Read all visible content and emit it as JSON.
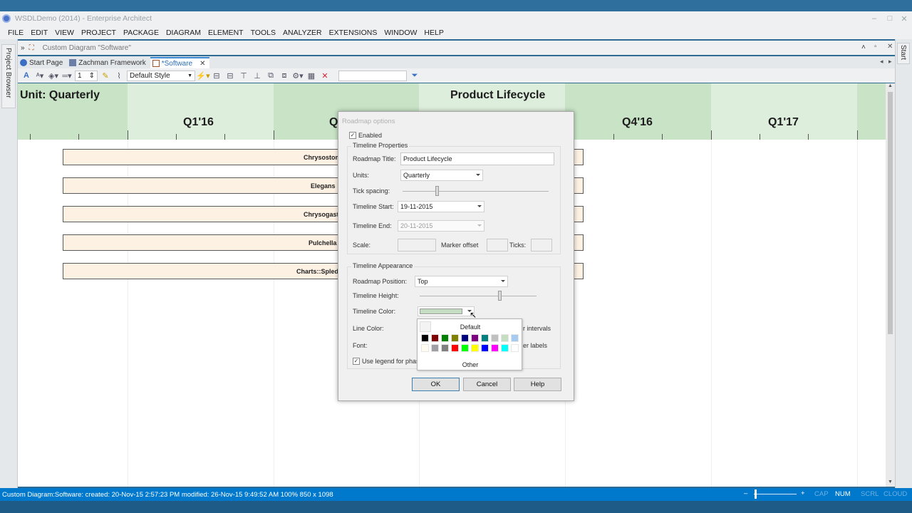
{
  "window": {
    "title": "WSDLDemo (2014) - Enterprise Architect"
  },
  "menu": [
    "FILE",
    "EDIT",
    "VIEW",
    "PROJECT",
    "PACKAGE",
    "DIAGRAM",
    "ELEMENT",
    "TOOLS",
    "ANALYZER",
    "EXTENSIONS",
    "WINDOW",
    "HELP"
  ],
  "side": {
    "left_tab": "Project Browser",
    "right_tab": "Start"
  },
  "doc_path": "Custom Diagram \"Software\"",
  "tabs": [
    {
      "label": "Start Page"
    },
    {
      "label": "Zachman Framework"
    },
    {
      "label": "*Software"
    }
  ],
  "toolbar": {
    "line_width": "1",
    "style": "Default Style",
    "search": ""
  },
  "diagram": {
    "unit_label": "Unit: Quarterly",
    "roadmap_title": "Product Lifecycle",
    "quarters": [
      "Q1'16",
      "Q",
      "Q4'16",
      "Q1'17"
    ],
    "bars": [
      "Chrysostom",
      "Elegans",
      "Chrysogaste",
      "Pulchella",
      "Charts::Splede"
    ],
    "band_colors": [
      "#c8e3c6",
      "#deeedc"
    ]
  },
  "dialog": {
    "title": "Roadmap options",
    "enabled_label": "Enabled",
    "enabled": true,
    "props_group": "Timeline Properties",
    "roadmap_title_label": "Roadmap Title:",
    "roadmap_title_value": "Product Lifecycle",
    "units_label": "Units:",
    "units_value": "Quarterly",
    "tick_spacing_label": "Tick spacing:",
    "start_label": "Timeline Start:",
    "start_value": "19-11-2015",
    "end_label": "Timeline End:",
    "end_value": "20-11-2015",
    "scale_label": "Scale:",
    "marker_label": "Marker offset",
    "ticks_label": "Ticks:",
    "appearance_group": "Timeline Appearance",
    "position_label": "Roadmap Position:",
    "position_value": "Top",
    "height_label": "Timeline Height:",
    "color_label": "Timeline Color:",
    "timeline_color": "#c5ddc2",
    "line_color_label": "Line Color:",
    "font_label": "Font:",
    "intervals_label": "r intervals",
    "labels_label": "er labels",
    "legend_label": "Use legend for phas",
    "legend_checked": true,
    "ok": "OK",
    "cancel": "Cancel",
    "help": "Help"
  },
  "color_popup": {
    "default_label": "Default",
    "other_label": "Other",
    "row1": [
      "#000000",
      "#7f0000",
      "#007f00",
      "#7f7f00",
      "#00007f",
      "#7f007f",
      "#007f7f",
      "#c0c0c0",
      "#c5ddc2",
      "#a6caf0"
    ],
    "row2": [
      "#fffbf0",
      "#a0a0a4",
      "#808080",
      "#ff0000",
      "#00ff00",
      "#ffff00",
      "#0000ff",
      "#ff00ff",
      "#00ffff",
      "#ffffff"
    ]
  },
  "status": {
    "text": "Custom Diagram:Software:  created: 20-Nov-15 2:57:23 PM  modified: 26-Nov-15 9:49:52 AM  100%  850 x 1098",
    "cap": "CAP",
    "num": "NUM",
    "scrl": "SCRL",
    "cloud": "CLOUD"
  }
}
